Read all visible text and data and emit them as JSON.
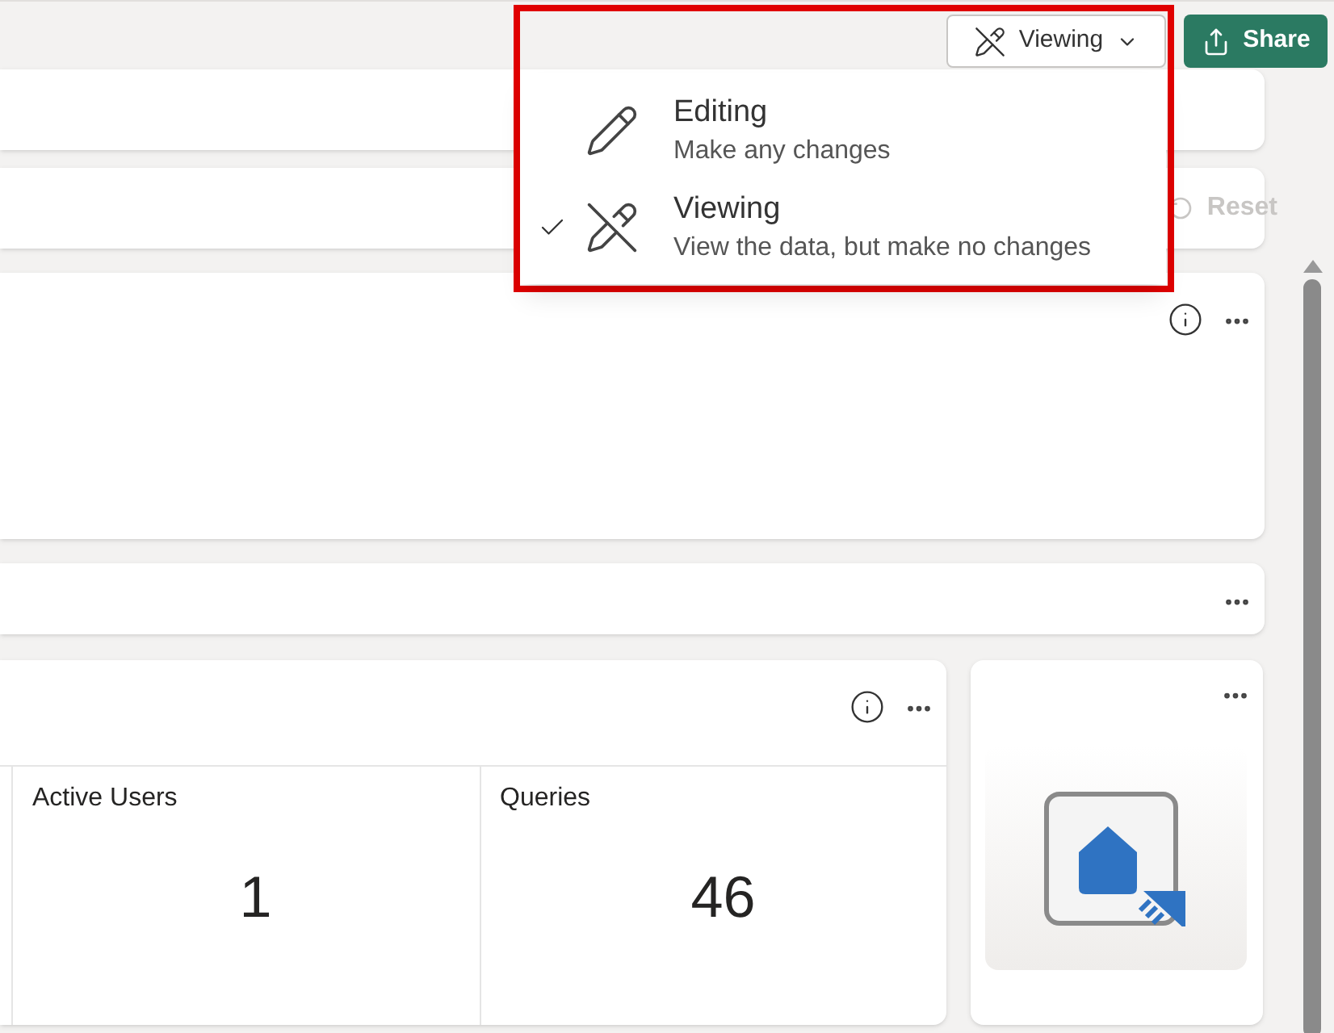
{
  "toolbar": {
    "mode_button": {
      "label": "Viewing"
    },
    "share_button": {
      "label": "Share"
    }
  },
  "mode_menu": {
    "items": [
      {
        "kind": "edit",
        "title": "Editing",
        "description": "Make any changes",
        "selected": false
      },
      {
        "kind": "view",
        "title": "Viewing",
        "description": "View the data, but make no changes",
        "selected": true
      }
    ]
  },
  "filter_bar": {
    "reset": {
      "label": "Reset",
      "disabled": true
    }
  },
  "metrics": [
    {
      "label": "Active Users",
      "value": "1"
    },
    {
      "label": "Queries",
      "value": "46"
    }
  ],
  "annotation": {
    "highlight_menu": true
  }
}
